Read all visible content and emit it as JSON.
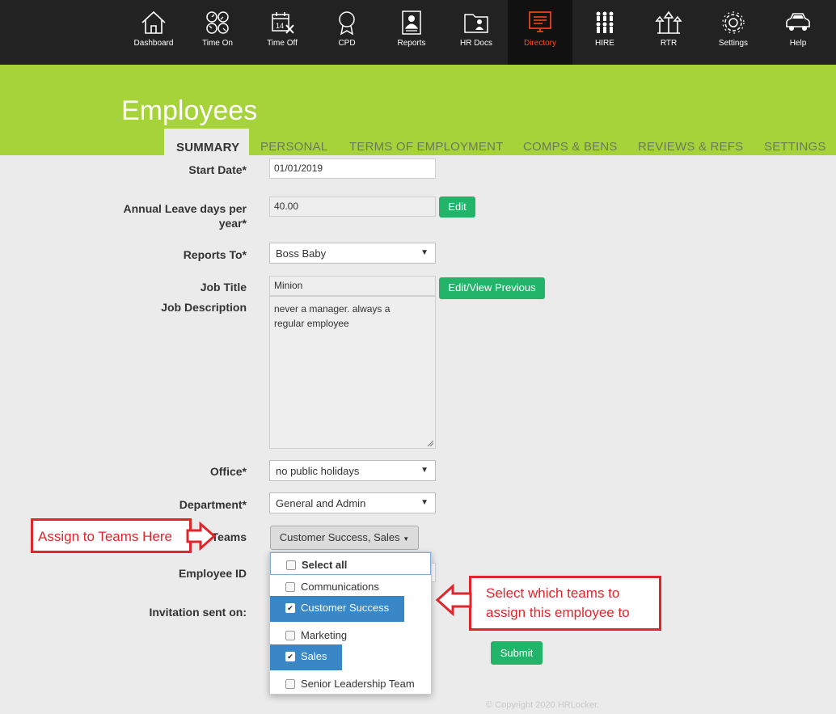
{
  "nav": {
    "items": [
      {
        "label": "Dashboard",
        "icon": "home-icon"
      },
      {
        "label": "Time On",
        "icon": "clock-arrows-icon"
      },
      {
        "label": "Time Off",
        "icon": "calendar-x-icon"
      },
      {
        "label": "CPD",
        "icon": "award-ribbon-icon"
      },
      {
        "label": "Reports",
        "icon": "report-person-icon"
      },
      {
        "label": "HR Docs",
        "icon": "folder-person-icon"
      },
      {
        "label": "Directory",
        "icon": "directory-monitor-icon"
      },
      {
        "label": "HIRE",
        "icon": "people-grid-icon"
      },
      {
        "label": "RTR",
        "icon": "building-arrows-icon"
      },
      {
        "label": "Settings",
        "icon": "gear-icon"
      },
      {
        "label": "Help",
        "icon": "car-icon"
      }
    ],
    "active": "Directory"
  },
  "colors": {
    "nav_bg": "#222222",
    "active_nav": "#ff4a1c",
    "hero": "#a6d23a",
    "green_button": "#22b569",
    "highlight": "#3a87c7",
    "annotation": "#e0252c"
  },
  "page": {
    "title": "Employees"
  },
  "tabs": [
    {
      "label": "SUMMARY"
    },
    {
      "label": "PERSONAL"
    },
    {
      "label": "TERMS OF EMPLOYMENT"
    },
    {
      "label": "COMPS & BENS"
    },
    {
      "label": "REVIEWS & REFS"
    },
    {
      "label": "SETTINGS"
    }
  ],
  "form": {
    "start_date": {
      "label": "Start Date*",
      "value": "01/01/2019"
    },
    "annual_leave": {
      "label_line1": "Annual Leave days per",
      "label_line2": "year*",
      "value": "40.00",
      "button": "Edit"
    },
    "reports_to": {
      "label": "Reports To*",
      "value": "Boss Baby"
    },
    "job_title": {
      "label": "Job Title",
      "value": "Minion",
      "button": "Edit/View Previous"
    },
    "job_description": {
      "label": "Job Description",
      "line1": "never a manager. always a",
      "line2": "regular employee"
    },
    "office": {
      "label": "Office*",
      "value": "no public holidays"
    },
    "department": {
      "label": "Department*",
      "value": "General and Admin"
    },
    "teams": {
      "label": "Teams",
      "value": "Customer Success, Sales"
    },
    "employee_id": {
      "label": "Employee ID"
    },
    "invitation": {
      "label": "Invitation sent on:"
    },
    "submit": "Submit"
  },
  "teams_dropdown": [
    {
      "label": "Select all",
      "checked": false
    },
    {
      "label": "Communications",
      "checked": false
    },
    {
      "label": "Customer Success",
      "checked": true
    },
    {
      "label": "Marketing",
      "checked": false
    },
    {
      "label": "Sales",
      "checked": true
    },
    {
      "label": "Senior Leadership Team",
      "checked": false
    }
  ],
  "annotations": {
    "assign_teams": "Assign to Teams Here",
    "select_teams_line1": "Select which teams to",
    "select_teams_line2": "assign this employee to"
  },
  "footer": {
    "copyright": "© Copyright 2020 HRLocker."
  }
}
